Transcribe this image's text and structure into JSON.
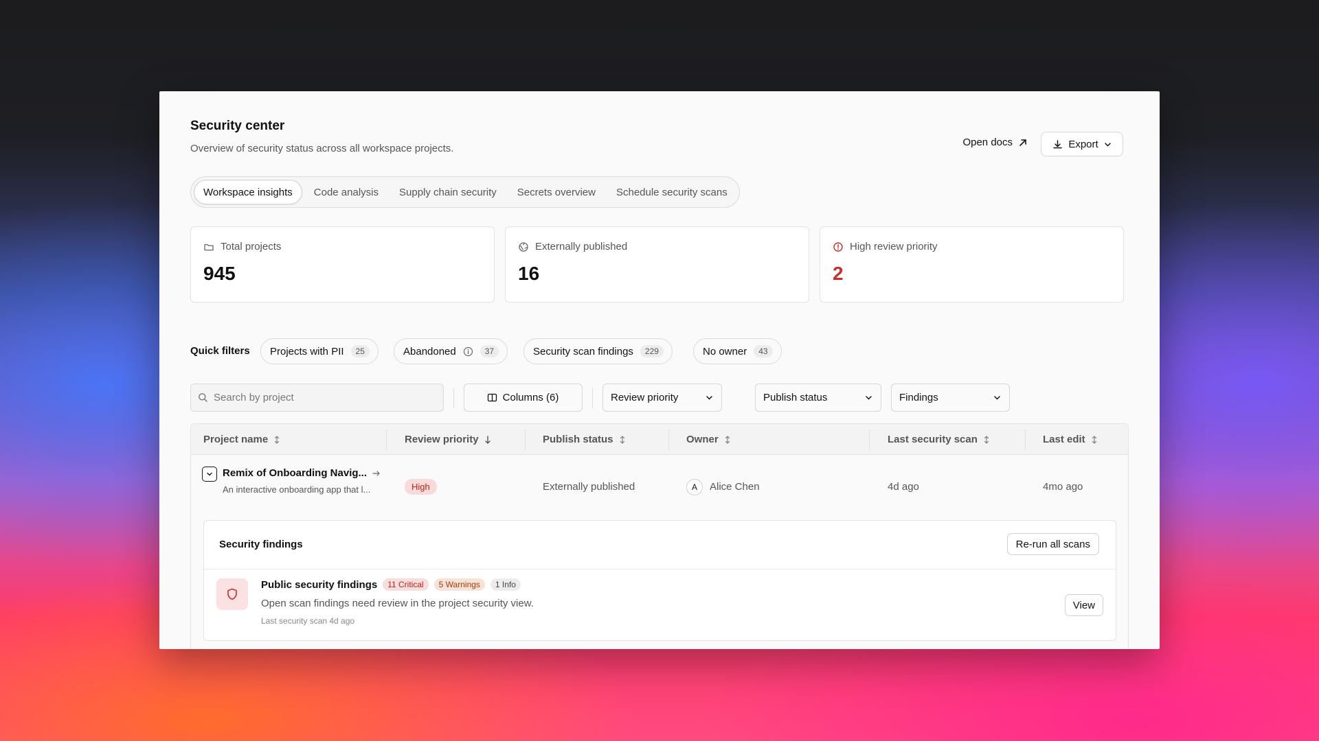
{
  "header": {
    "title": "Security center",
    "subtitle": "Overview of security status across all workspace projects.",
    "open_docs": "Open docs",
    "export": "Export"
  },
  "tabs": [
    {
      "label": "Workspace insights",
      "active": true
    },
    {
      "label": "Code analysis",
      "active": false
    },
    {
      "label": "Supply chain security",
      "active": false
    },
    {
      "label": "Secrets overview",
      "active": false
    },
    {
      "label": "Schedule security scans",
      "active": false
    }
  ],
  "stats": [
    {
      "label": "Total projects",
      "value": "945",
      "icon": "folder-icon"
    },
    {
      "label": "Externally published",
      "value": "16",
      "icon": "globe-icon"
    },
    {
      "label": "High review priority",
      "value": "2",
      "icon": "alert-circle-icon",
      "value_color": "#c9302c"
    }
  ],
  "quick_filters": {
    "label": "Quick filters",
    "chips": [
      {
        "label": "Projects with PII",
        "count": "25"
      },
      {
        "label": "Abandoned",
        "count": "37",
        "icon": "info-icon"
      },
      {
        "label": "Security scan findings",
        "count": "229"
      },
      {
        "label": "No owner",
        "count": "43"
      }
    ]
  },
  "toolbar": {
    "search_placeholder": "Search by project",
    "columns": "Columns (6)",
    "dropdowns": [
      "Review priority",
      "Publish status",
      "Findings"
    ]
  },
  "table": {
    "columns": [
      "Project name",
      "Review priority",
      "Publish status",
      "Owner",
      "Last security scan",
      "Last edit"
    ],
    "rows": [
      {
        "name": "Remix of Onboarding Navig...",
        "description": "An interactive onboarding app that l...",
        "priority": "High",
        "publish_status": "Externally published",
        "owner_initial": "A",
        "owner": "Alice Chen",
        "last_scan": "4d ago",
        "last_edit": "4mo ago"
      }
    ]
  },
  "findings": {
    "title": "Security findings",
    "rerun": "Re-run all scans",
    "item": {
      "title": "Public security findings",
      "critical": "11 Critical",
      "warnings": "5 Warnings",
      "info": "1 Info",
      "description": "Open scan findings need review in the project security view.",
      "meta": "Last security scan 4d ago",
      "view": "View"
    }
  },
  "colors": {
    "critical": "#b3261e",
    "high_value": "#c9302c"
  }
}
